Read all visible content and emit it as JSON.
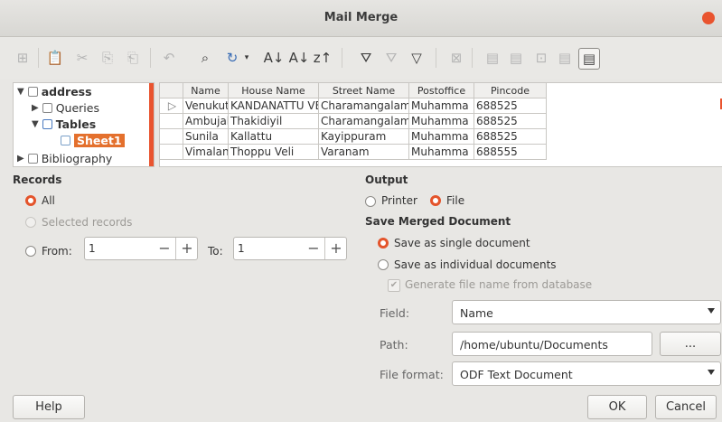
{
  "window": {
    "title": "Mail Merge"
  },
  "toolbar": {
    "icons": [
      "insert-icon",
      "paste-icon",
      "cut-icon",
      "copy-icon",
      "paste-special-icon",
      "undo-icon",
      "find-icon",
      "refresh-icon",
      "sort-ascending-icon",
      "sort-descending-icon",
      "sort-icon",
      "autofilter-icon",
      "standard-filter-icon",
      "reset-filter-icon",
      "remove-filter-icon",
      "data-to-text-icon",
      "data-to-fields-icon",
      "mail-merge-icon",
      "data-source-current-icon",
      "explorer-toggle-icon"
    ]
  },
  "tree": {
    "root": "address",
    "queries": "Queries",
    "tables": "Tables",
    "sheet": "Sheet1",
    "bibliography": "Bibliography"
  },
  "grid": {
    "headers": [
      "Name",
      "House Name",
      "Street Name",
      "Postoffice",
      "Pincode"
    ],
    "rows": [
      [
        "Venukutti",
        "KANDANATTU VE",
        "Charamangalam",
        "Muhamma",
        "688525"
      ],
      [
        "Ambujaks",
        "Thakidiyil",
        "Charamangalam",
        "Muhamma",
        "688525"
      ],
      [
        "Sunila",
        "Kallattu",
        "Kayippuram",
        "Muhamma",
        "688525"
      ],
      [
        "Vimalan",
        "Thoppu Veli",
        "Varanam",
        "Muhamma",
        "688555"
      ]
    ]
  },
  "records": {
    "heading": "Records",
    "all": "All",
    "selected": "Selected records",
    "from": "From:",
    "from_value": "1",
    "to": "To:",
    "to_value": "1"
  },
  "output": {
    "heading": "Output",
    "printer": "Printer",
    "file": "File",
    "save_heading": "Save Merged Document",
    "single": "Save as single document",
    "individual": "Save as individual documents",
    "generate": "Generate file name from database",
    "field_label": "Field:",
    "field_value": "Name",
    "path_label": "Path:",
    "path_value": "/home/ubuntu/Documents",
    "browse": "...",
    "format_label": "File format:",
    "format_value": "ODF Text Document"
  },
  "buttons": {
    "help": "Help",
    "ok": "OK",
    "cancel": "Cancel"
  },
  "colors": {
    "accent": "#e9542f",
    "selection": "#e4702d"
  }
}
